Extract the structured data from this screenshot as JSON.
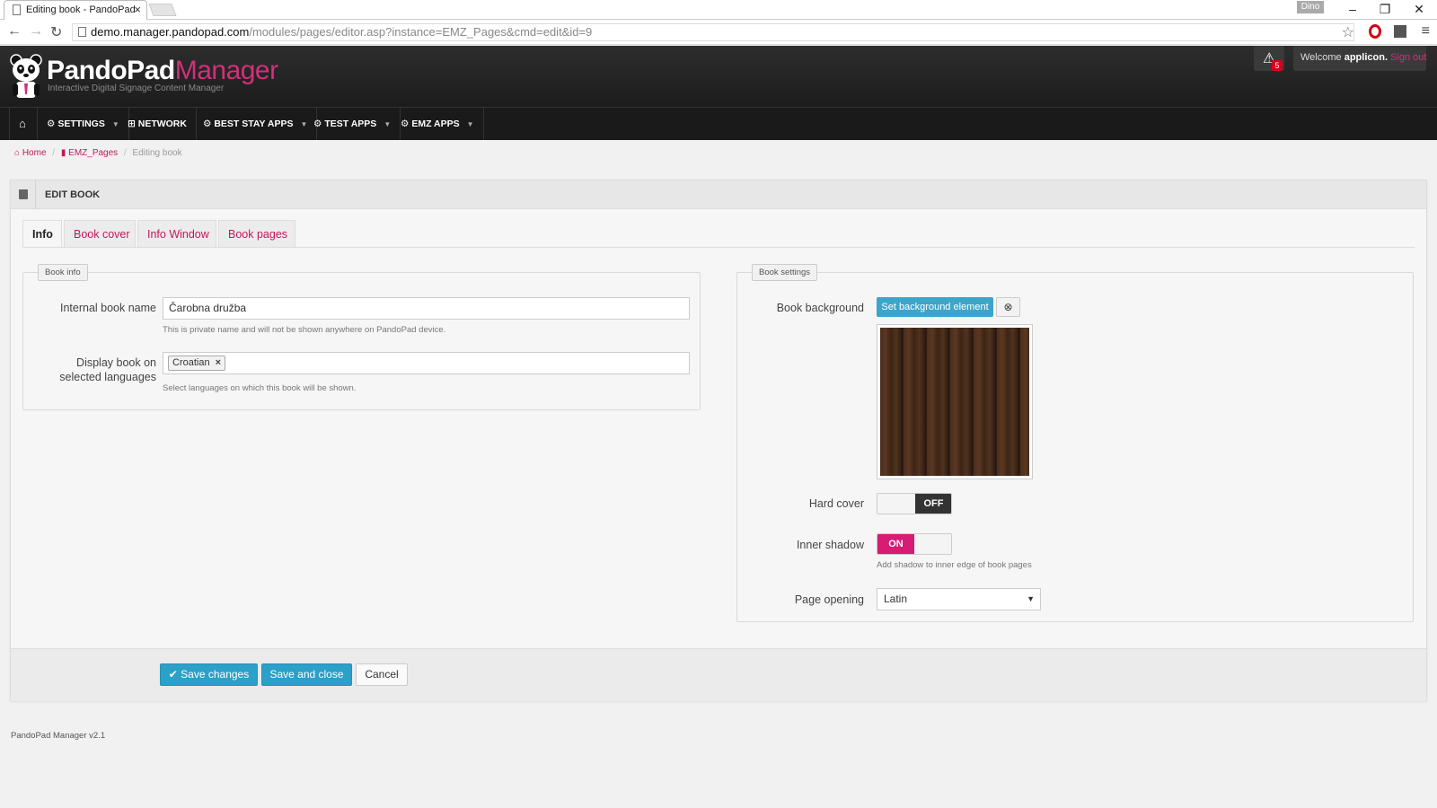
{
  "browser": {
    "tab_title": "Editing book - PandoPad",
    "user_badge": "Dino",
    "url_host": "demo.manager.pandopad.com",
    "url_path": "/modules/pages/editor.asp?instance=EMZ_Pages&cmd=edit&id=9"
  },
  "header": {
    "logo_main": "PandoPad",
    "logo_accent": "Manager",
    "tagline": "Interactive Digital Signage Content Manager",
    "alert_count": "5",
    "welcome_prefix": "Welcome",
    "username": "applicon.",
    "signout": "Sign out"
  },
  "navbar": {
    "items": [
      {
        "label": "SETTINGS",
        "icon": "gear-icon"
      },
      {
        "label": "NETWORK",
        "icon": "sitemap-icon"
      },
      {
        "label": "BEST STAY APPS",
        "icon": "gears-icon"
      },
      {
        "label": "TEST APPS",
        "icon": "gears-icon"
      },
      {
        "label": "EMZ APPS",
        "icon": "gears-icon"
      }
    ]
  },
  "breadcrumb": {
    "home": "Home",
    "section": "EMZ_Pages",
    "current": "Editing book"
  },
  "panel": {
    "title": "EDIT BOOK",
    "tabs": [
      "Info",
      "Book cover",
      "Info Window",
      "Book pages"
    ],
    "active_tab": "Info"
  },
  "book_info": {
    "legend": "Book info",
    "name_label": "Internal book name",
    "name_value": "Čarobna družba",
    "name_help": "This is private name and will not be shown anywhere on PandoPad device.",
    "lang_label_1": "Display book on",
    "lang_label_2": "selected languages",
    "lang_tag": "Croatian",
    "lang_help": "Select languages on which this book will be shown."
  },
  "book_settings": {
    "legend": "Book settings",
    "bg_label": "Book background",
    "bg_button": "Set background element",
    "hard_cover_label": "Hard cover",
    "hard_cover_state": "OFF",
    "inner_shadow_label": "Inner shadow",
    "inner_shadow_state": "ON",
    "inner_shadow_help": "Add shadow to inner edge of book pages",
    "page_opening_label": "Page opening",
    "page_opening_value": "Latin"
  },
  "actions": {
    "save": "Save changes",
    "save_close": "Save and close",
    "cancel": "Cancel"
  },
  "footer": {
    "version": "PandoPad Manager v2.1"
  },
  "colors": {
    "accent": "#d0317a",
    "button_blue": "#2ba0c8",
    "toggle_on": "#d81b74"
  }
}
